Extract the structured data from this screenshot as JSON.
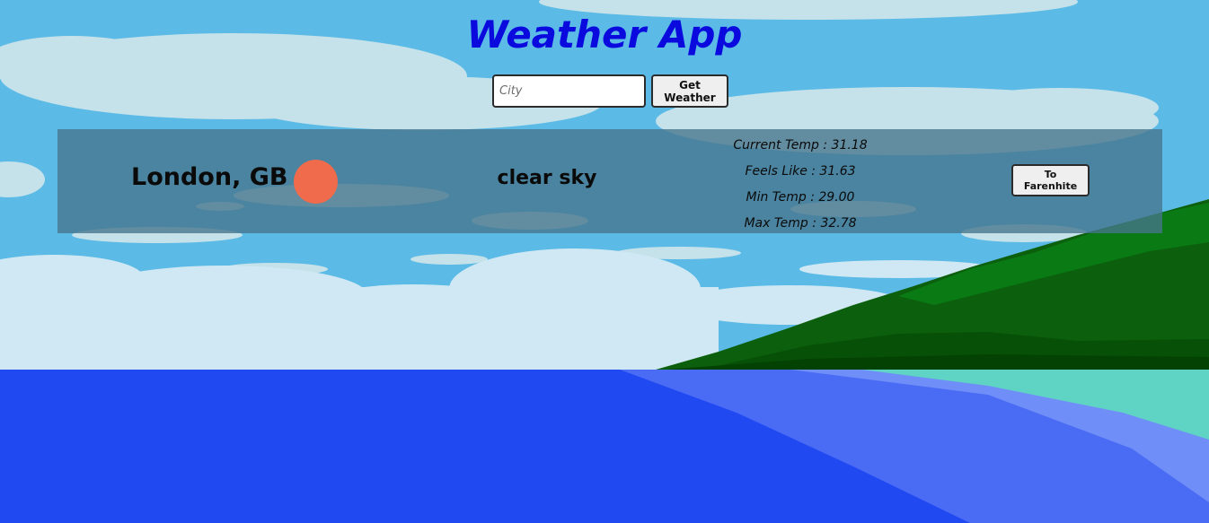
{
  "app": {
    "title": "Weather App"
  },
  "search": {
    "placeholder": "City",
    "value": "",
    "button_label": "Get Weather"
  },
  "weather": {
    "location": "London, GB",
    "icon": "sun-icon",
    "description": "clear sky",
    "current_temp": "Current Temp : 31.18",
    "feels_like": "Feels Like : 31.63",
    "min_temp": "Min Temp : 29.00",
    "max_temp": "Max Temp : 32.78",
    "unit_toggle_label": "To Farenhite"
  },
  "colors": {
    "title": "#0a0adf",
    "sky": "#5bbbe6",
    "sea": "#2149f2",
    "sun": "#ef6b4c",
    "panel": "#47758c",
    "forest": "#0b5c0b"
  }
}
